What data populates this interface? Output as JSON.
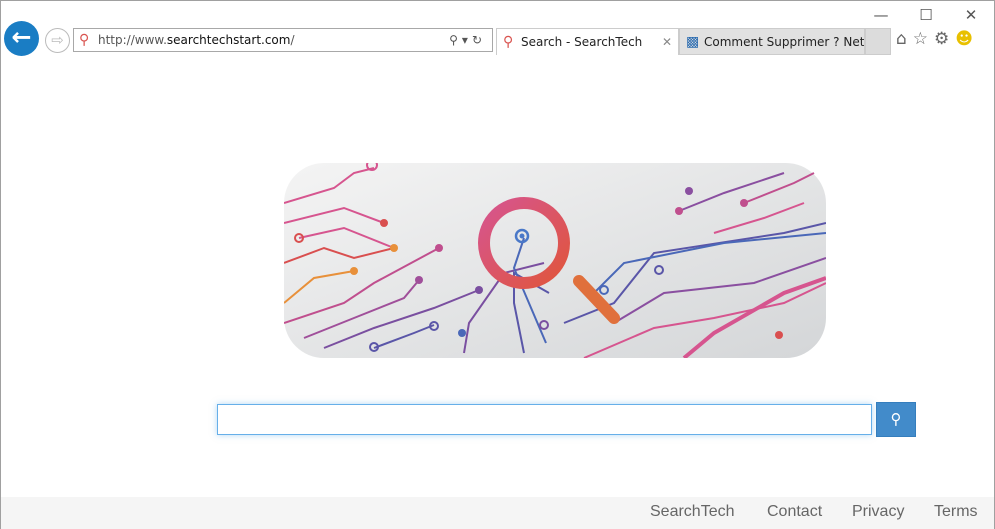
{
  "browser": {
    "url_prefix": "http://www.",
    "url_domain": "searchtechstart.com",
    "url_suffix": "/",
    "tabs": [
      {
        "title": "Search - SearchTech",
        "active": true,
        "icon": "search-icon"
      },
      {
        "title": "Comment Supprimer ? Net...",
        "active": false,
        "icon": "recycle-bin-icon"
      }
    ],
    "toolbar_icons": [
      "home-icon",
      "favorites-star-icon",
      "settings-gear-icon",
      "feedback-smiley-icon"
    ]
  },
  "page": {
    "search_value": "",
    "colors": {
      "accent": "#428bca",
      "logo_pink": "#d6558f",
      "logo_purple": "#7a4fa0"
    }
  },
  "footer": {
    "links": [
      "SearchTech",
      "Contact",
      "Privacy",
      "Terms"
    ]
  }
}
